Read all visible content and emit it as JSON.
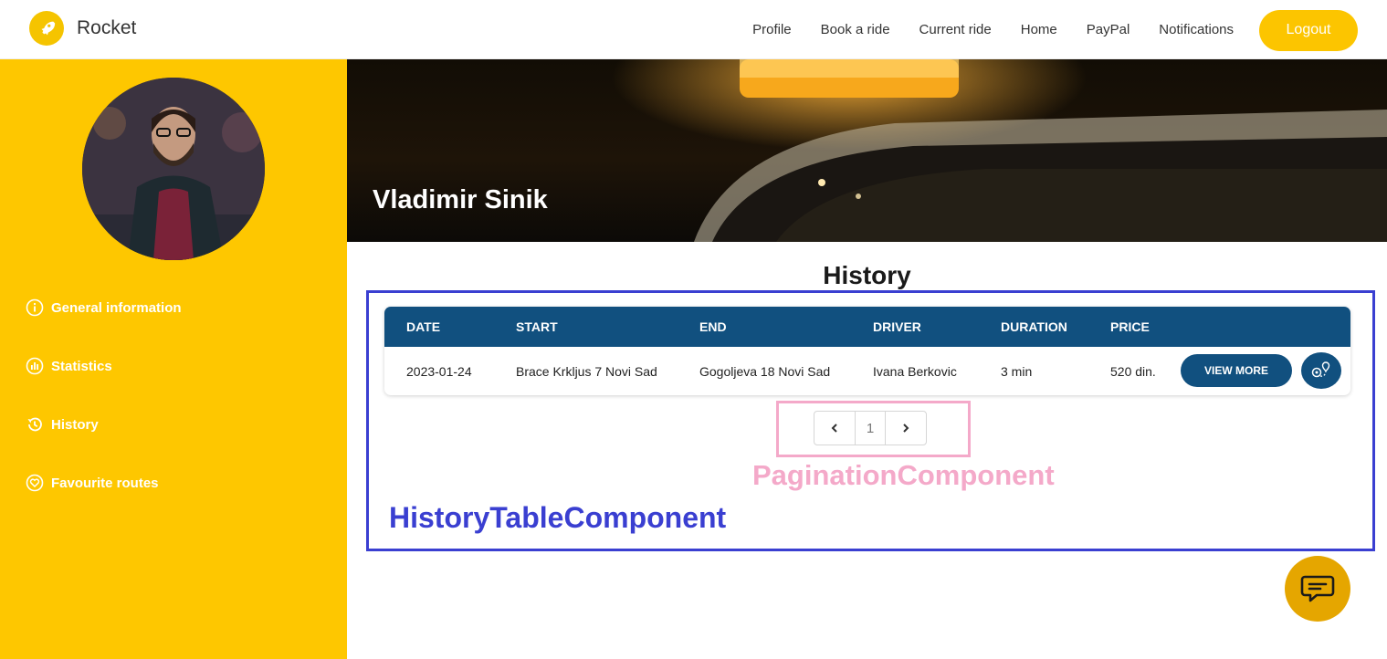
{
  "navbar": {
    "brand": "Rocket",
    "links": [
      "Profile",
      "Book a ride",
      "Current ride",
      "Home",
      "PayPal",
      "Notifications"
    ],
    "logout_label": "Logout"
  },
  "sidebar": {
    "items": [
      {
        "label": "General information",
        "icon": "info-icon"
      },
      {
        "label": "Statistics",
        "icon": "statistics-icon"
      },
      {
        "label": "History",
        "icon": "history-icon"
      },
      {
        "label": "Favourite routes",
        "icon": "heart-icon"
      }
    ]
  },
  "banner": {
    "name": "Vladimir Sinik"
  },
  "history": {
    "title": "History",
    "columns": [
      "DATE",
      "START",
      "END",
      "DRIVER",
      "DURATION",
      "PRICE"
    ],
    "rows": [
      {
        "date": "2023-01-24",
        "start": "Brace Krkljus 7 Novi Sad",
        "end": "Gogoljeva 18 Novi Sad",
        "driver": "Ivana Berkovic",
        "duration": "3 min",
        "price": "520 din."
      }
    ],
    "view_more_label": "VIEW MORE"
  },
  "pagination": {
    "prev": "‹",
    "current_page": "1",
    "next": "›"
  },
  "annotations": {
    "pagination_component": "PaginationComponent",
    "history_table_component": "HistoryTableComponent"
  },
  "colors": {
    "brand_yellow": "#fec700",
    "table_header": "#11507f",
    "history_outline": "#3a3fd1",
    "pagination_outline": "#f4a9c9"
  }
}
